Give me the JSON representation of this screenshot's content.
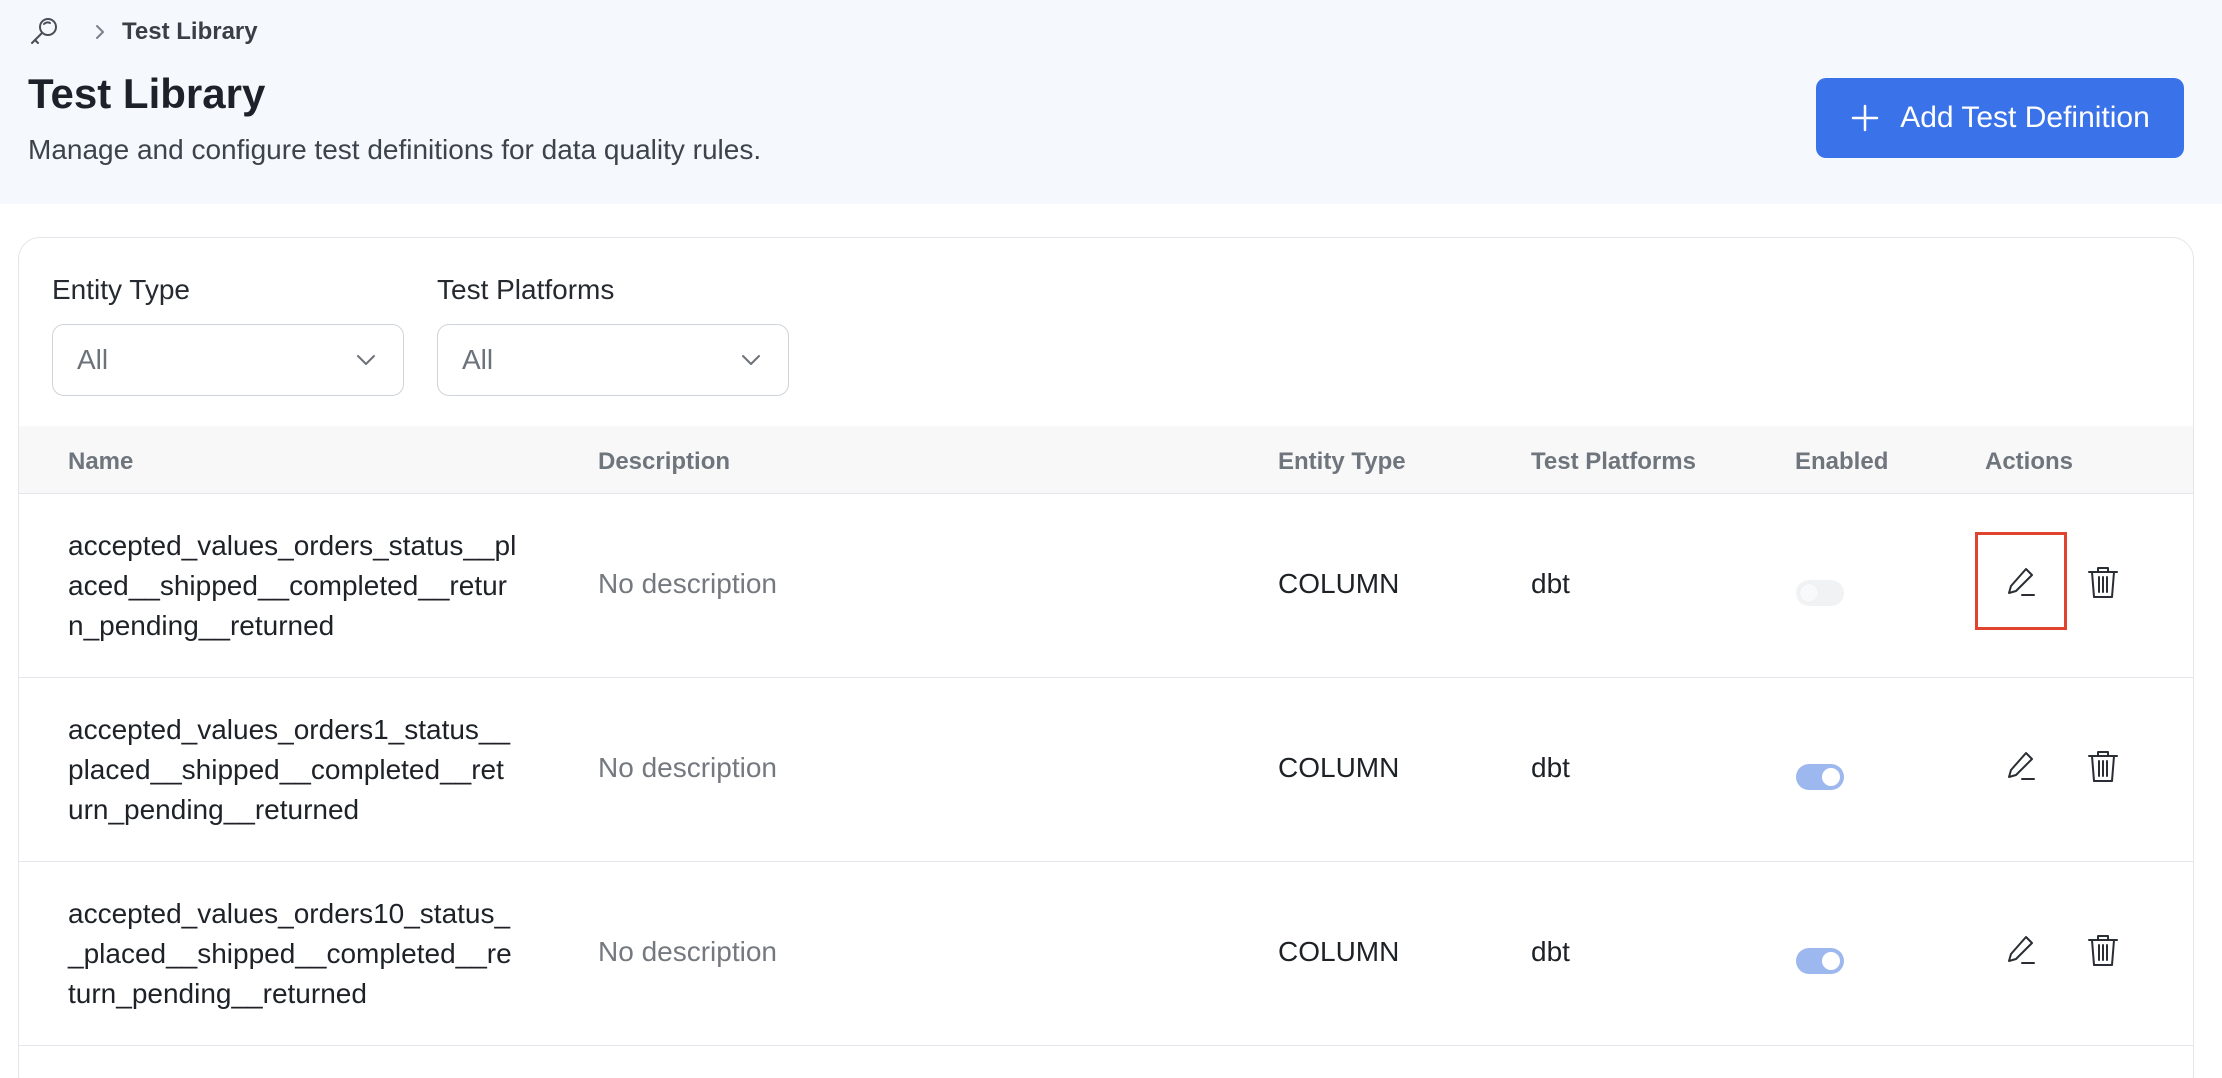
{
  "breadcrumb": {
    "current": "Test Library"
  },
  "page": {
    "title": "Test Library",
    "subtitle": "Manage and configure test definitions for data quality rules.",
    "add_button_label": "Add Test Definition"
  },
  "filters": {
    "entity_type": {
      "label": "Entity Type",
      "value": "All"
    },
    "test_platforms": {
      "label": "Test Platforms",
      "value": "All"
    }
  },
  "table": {
    "columns": [
      "Name",
      "Description",
      "Entity Type",
      "Test Platforms",
      "Enabled",
      "Actions"
    ],
    "rows": [
      {
        "name": "accepted_values_orders_status__placed__shipped__completed__return_pending__returned",
        "description": "No description",
        "entity_type": "COLUMN",
        "platforms": "dbt",
        "enabled": false
      },
      {
        "name": "accepted_values_orders1_status__placed__shipped__completed__return_pending__returned",
        "description": "No description",
        "entity_type": "COLUMN",
        "platforms": "dbt",
        "enabled": true
      },
      {
        "name": "accepted_values_orders10_status__placed__shipped__completed__return_pending__returned",
        "description": "No description",
        "entity_type": "COLUMN",
        "platforms": "dbt",
        "enabled": true
      }
    ]
  },
  "highlighted_action": {
    "row": 0,
    "action": "edit"
  },
  "colors": {
    "accent": "#3a72e9",
    "header_bg": "#f5f8fd",
    "toggle_on": "#9db7ef",
    "highlight": "#e0432e"
  }
}
